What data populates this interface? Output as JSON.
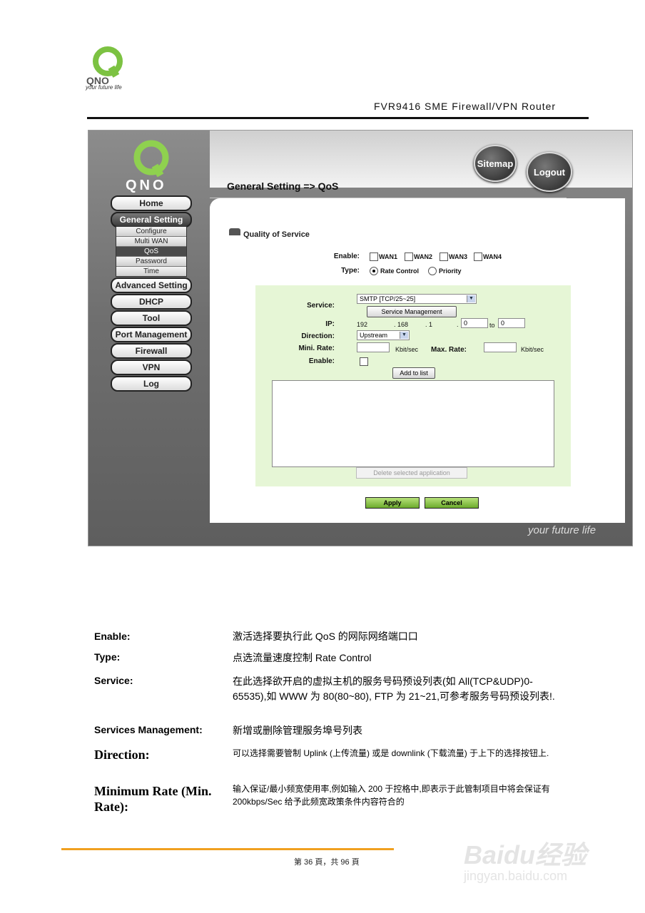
{
  "header": {
    "logo_text": "QNO",
    "tagline": "your future life",
    "title": "FVR9416 SME Firewall/VPN Router"
  },
  "router_ui": {
    "brand": "QNO",
    "page_heading": "General Setting => QoS",
    "sitemap_label": "Sitemap",
    "logout_label": "Logout",
    "nav": [
      "Home",
      "General Setting",
      "Advanced Setting",
      "DHCP",
      "Tool",
      "Port Management",
      "Firewall",
      "VPN",
      "Log"
    ],
    "sub_nav": [
      "Configure",
      "Multi WAN",
      "QoS",
      "Password",
      "Time"
    ],
    "section_title": "Quality of Service",
    "enable_label": "Enable:",
    "wan_options": [
      "WAN1",
      "WAN2",
      "WAN3",
      "WAN4"
    ],
    "type_label": "Type:",
    "type_options": [
      "Rate Control",
      "Priority"
    ],
    "service_label": "Service:",
    "service_value": "SMTP [TCP/25~25]",
    "service_mgmt_button": "Service Management",
    "ip_label": "IP:",
    "ip_parts": [
      "192",
      ". 168",
      ". 1",
      "."
    ],
    "ip_from": "0",
    "to_label": "to",
    "ip_to": "0",
    "direction_label": "Direction:",
    "direction_value": "Upstream",
    "min_rate_label": "Mini. Rate:",
    "max_rate_label": "Max. Rate:",
    "unit": "Kbit/sec",
    "enable2_label": "Enable:",
    "add_button": "Add to list",
    "delete_button": "Delete selected application",
    "apply_button": "Apply",
    "cancel_button": "Cancel",
    "footer_slogan": "your future life"
  },
  "descriptions": [
    {
      "term": "Enable:",
      "text": "激活选择要执行此 QoS 的网际网络端口口"
    },
    {
      "term": "Type:",
      "text": "点选流量速度控制 Rate Control"
    },
    {
      "term": "Service:",
      "text": "在此选择欲开启的虚拟主机的服务号码预设列表(如 All(TCP&UDP)0-65535),如 WWW 为 80(80~80), FTP 为 21~21,可参考服务号码预设列表!."
    },
    {
      "term": "Services Management:",
      "text": "新增或删除管理服务埠号列表"
    },
    {
      "term": "Direction:",
      "text": "可以选择需要管制 Uplink (上传流量) 或是 downlink (下载流量) 于上下的选择按钮上."
    },
    {
      "term": "Minimum Rate (Min. Rate):",
      "text": "输入保证/最小频宽使用率,例如输入 200 于控格中,即表示于此管制项目中将会保证有 200kbps/Sec 给予此频宽政策条件内容符合的"
    }
  ],
  "footer": {
    "page": "第 36 頁，共 96 頁",
    "watermark_main": "Baidu经验",
    "watermark_sub": "jingyan.baidu.com"
  },
  "colors": {
    "accent_green": "#6cab2c",
    "form_bg": "#e6f6d6",
    "footer_rule": "#f0a020"
  }
}
